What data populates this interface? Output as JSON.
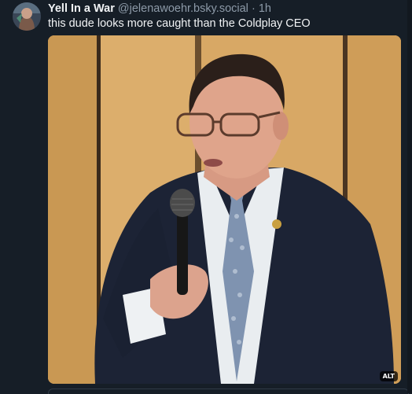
{
  "post": {
    "author_name": "Yell In a War",
    "handle": "@jelenawoehr.bsky.social",
    "separator": "·",
    "timestamp": "1h",
    "text": "this dude looks more caught than the Coldplay CEO",
    "media": {
      "alt_badge": "ALT"
    }
  }
}
